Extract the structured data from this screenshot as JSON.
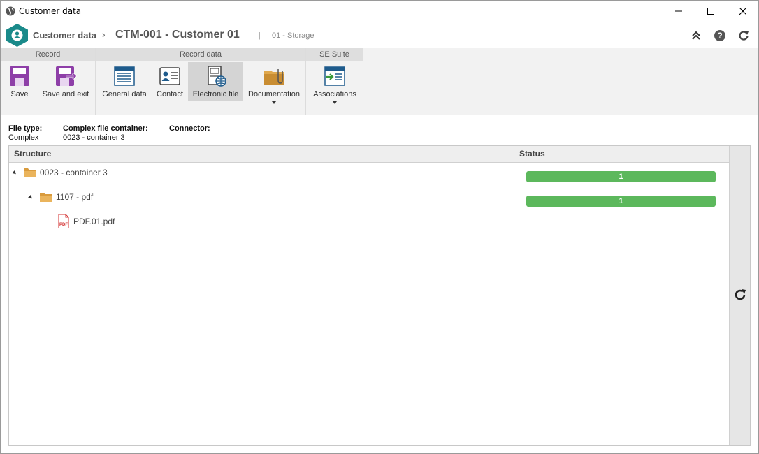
{
  "window": {
    "title": "Customer data",
    "icon": "globe-icon",
    "controls": [
      "minimize-icon",
      "maximize-icon",
      "close-icon"
    ]
  },
  "header": {
    "breadcrumb_root": "Customer data",
    "breadcrumb_separator": "›",
    "record_title": "CTM-001 - Customer 01",
    "pipe": "|",
    "subtitle": "01 - Storage",
    "icons": [
      "collapse-up-icon",
      "help-icon",
      "refresh-icon"
    ]
  },
  "ribbon": {
    "groups": [
      {
        "label": "Record",
        "buttons": [
          {
            "label": "Save",
            "icon": "save-icon"
          },
          {
            "label": "Save and exit",
            "icon": "save-exit-icon"
          }
        ]
      },
      {
        "label": "Record data",
        "buttons": [
          {
            "label": "General data",
            "icon": "general-data-icon"
          },
          {
            "label": "Contact",
            "icon": "contact-icon"
          },
          {
            "label": "Electronic file",
            "icon": "electronic-file-icon",
            "active": true
          },
          {
            "label": "Documentation",
            "icon": "documentation-icon",
            "dropdown": true
          }
        ]
      },
      {
        "label": "SE Suite",
        "buttons": [
          {
            "label": "Associations",
            "icon": "associations-icon",
            "dropdown": true
          }
        ]
      }
    ]
  },
  "info": {
    "file_type_label": "File type:",
    "file_type_value": "Complex",
    "container_label": "Complex file container:",
    "container_value": "0023 - container 3",
    "connector_label": "Connector:"
  },
  "grid": {
    "columns": {
      "structure": "Structure",
      "status": "Status"
    },
    "rows": [
      {
        "label": "0023 - container 3",
        "type": "folder",
        "level": 0,
        "status": "1",
        "status_color": "#5cb85c"
      },
      {
        "label": "1107 - pdf",
        "type": "folder",
        "level": 1,
        "status": "1",
        "status_color": "#5cb85c"
      },
      {
        "label": "PDF.01.pdf",
        "type": "pdf",
        "level": 2
      }
    ]
  },
  "colors": {
    "accent": "#1a8a8a",
    "purple": "#8e3fa8",
    "status_green": "#5cb85c",
    "folder": "#e0a84d",
    "pdf_red": "#d32f2f"
  }
}
